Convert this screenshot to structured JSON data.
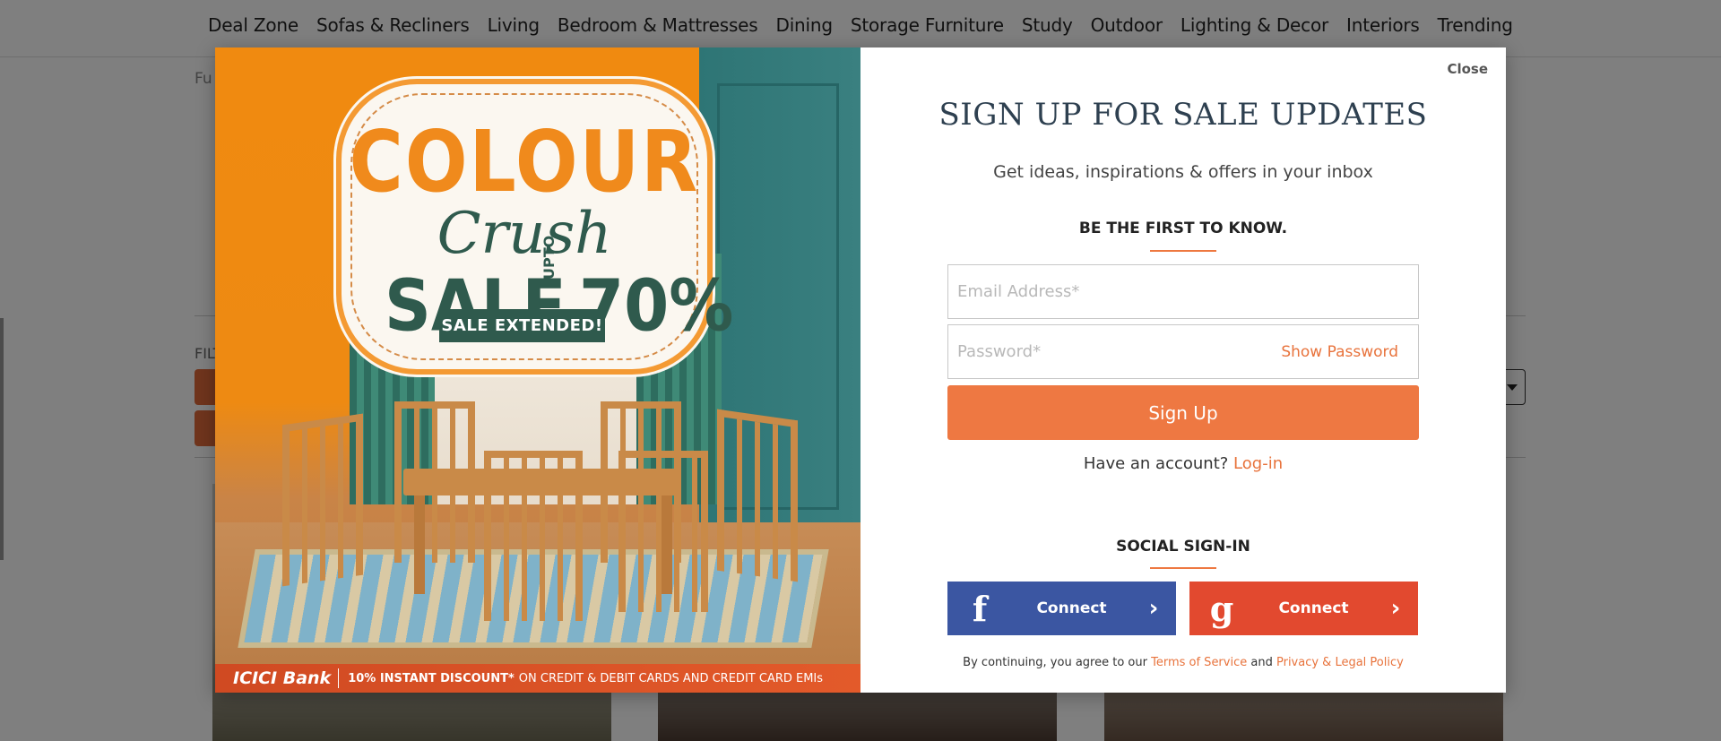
{
  "nav": {
    "items": [
      "Deal Zone",
      "Sofas & Recliners",
      "Living",
      "Bedroom & Mattresses",
      "Dining",
      "Storage Furniture",
      "Study",
      "Outdoor",
      "Lighting & Decor",
      "Interiors",
      "Trending"
    ]
  },
  "background": {
    "breadcrumb": "Fu",
    "filter_label": "FILT"
  },
  "promo": {
    "line1": "COLOUR",
    "line2": "Crush",
    "line3": "SALE",
    "upto": "UPTO",
    "percent": "70%",
    "sale_extended": "SALE EXTENDED!",
    "bank": "ICICI Bank",
    "bank_discount": "10% INSTANT DISCOUNT*",
    "bank_terms": "ON CREDIT & DEBIT CARDS AND CREDIT CARD EMIs"
  },
  "modal": {
    "close": "Close",
    "title": "SIGN UP FOR SALE UPDATES",
    "subtitle": "Get ideas, inspirations & offers in your inbox",
    "first_to_know": "BE THE FIRST TO KNOW.",
    "email_placeholder": "Email Address*",
    "password_placeholder": "Password*",
    "show_password": "Show Password",
    "signup": "Sign Up",
    "have_account": "Have an account?",
    "login": "Log-in",
    "social_title": "SOCIAL SIGN-IN",
    "facebook_connect": "Connect",
    "google_connect": "Connect",
    "terms_prefix": "By continuing, you agree to our",
    "terms_link": "Terms of Service",
    "terms_and": "and",
    "privacy_link": "Privacy & Legal Policy"
  },
  "colors": {
    "accent": "#ee7842",
    "facebook": "#3b56a2",
    "google": "#e2492f",
    "title": "#2e4050"
  }
}
